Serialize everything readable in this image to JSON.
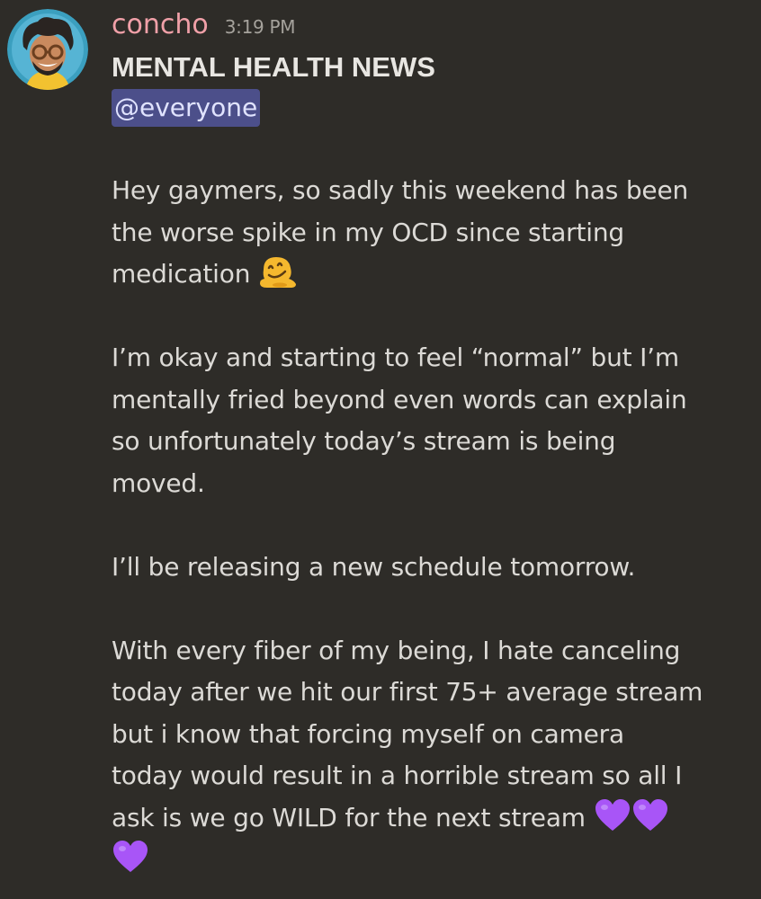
{
  "message": {
    "author": "concho",
    "timestamp": "3:19 PM",
    "heading": "MENTAL HEALTH NEWS",
    "mention": "@everyone",
    "paragraphs": [
      {
        "lines": [
          "Hey gaymers, so sadly this weekend has been",
          "the worse spike in my OCD since starting",
          "medication"
        ]
      },
      {
        "lines": [
          "I’m okay and starting to feel “normal” but I’m",
          "mentally fried beyond even words can explain",
          "so unfortunately today’s stream is being",
          "moved."
        ]
      },
      {
        "lines": [
          "I’ll be releasing a new schedule tomorrow."
        ]
      },
      {
        "lines": [
          "With every fiber of my being, I hate canceling",
          "today after we hit our first 75+ average stream",
          "but i know that forcing myself on camera",
          "today would result in a horrible stream so all I",
          "ask is we go WILD for the next stream"
        ]
      }
    ]
  },
  "emojis": {
    "melting_face": "melting-face-emoji",
    "purple_heart": "purple-heart-emoji"
  },
  "colors": {
    "background": "#2e2c28",
    "username": "#f0a0a8",
    "mention_bg": "#4c4f8a",
    "heart": "#a855f7",
    "melting_face": "#f5b82e"
  }
}
